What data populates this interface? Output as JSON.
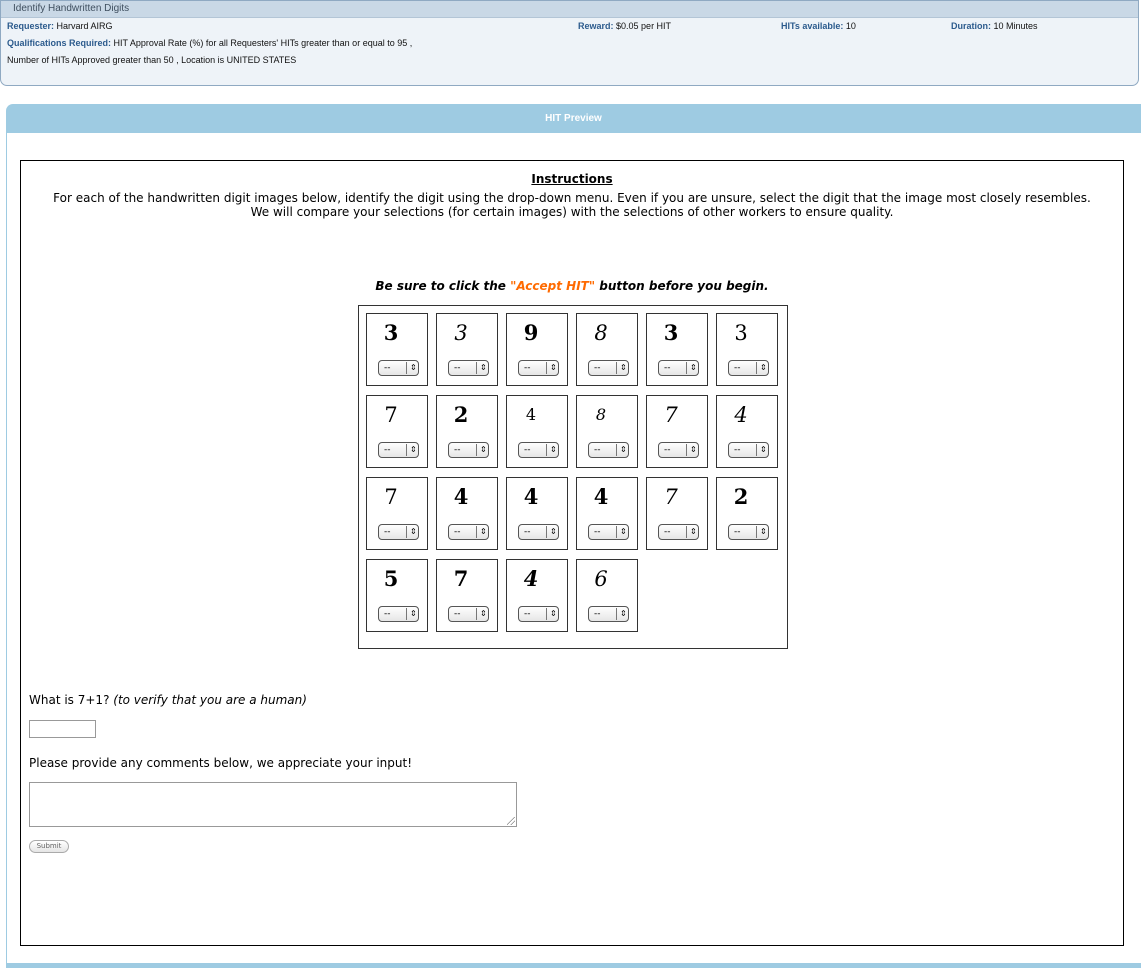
{
  "hit": {
    "title": "Identify Handwritten Digits",
    "requester_label": "Requester:",
    "requester": "Harvard AIRG",
    "reward_label": "Reward:",
    "reward": "$0.05 per HIT",
    "available_label": "HITs available:",
    "available": "10",
    "duration_label": "Duration:",
    "duration": "10 Minutes",
    "quals_label": "Qualifications Required:",
    "quals_line1": "HIT Approval Rate (%) for all Requesters' HITs  greater than or equal to  95 ,",
    "quals_line2": "Number of HITs Approved  greater than  50 , Location  is  UNITED STATES"
  },
  "preview": {
    "title": "HIT Preview"
  },
  "instructions": {
    "title": "Instructions",
    "line1": "For each of the handwritten digit images below, identify the digit using the drop-down menu. Even if you are unsure, select the digit that the image most closely resembles.",
    "line2": "We will compare your selections (for certain images) with the selections of other workers to ensure quality.",
    "accept_pre": "Be sure to click the ",
    "accept_hl": "\"Accept HIT\"",
    "accept_post": " button before you begin."
  },
  "digits": [
    {
      "glyph": "3",
      "value": "--"
    },
    {
      "glyph": "3",
      "value": "--"
    },
    {
      "glyph": "9",
      "value": "--"
    },
    {
      "glyph": "8",
      "value": "--"
    },
    {
      "glyph": "3",
      "value": "--"
    },
    {
      "glyph": "3",
      "value": "--"
    },
    {
      "glyph": "7",
      "value": "--"
    },
    {
      "glyph": "2",
      "value": "--"
    },
    {
      "glyph": "4",
      "value": "--"
    },
    {
      "glyph": "8",
      "value": "--"
    },
    {
      "glyph": "7",
      "value": "--"
    },
    {
      "glyph": "4",
      "value": "--"
    },
    {
      "glyph": "7",
      "value": "--"
    },
    {
      "glyph": "4",
      "value": "--"
    },
    {
      "glyph": "4",
      "value": "--"
    },
    {
      "glyph": "4",
      "value": "--"
    },
    {
      "glyph": "7",
      "value": "--"
    },
    {
      "glyph": "2",
      "value": "--"
    },
    {
      "glyph": "5",
      "value": "--"
    },
    {
      "glyph": "7",
      "value": "--"
    },
    {
      "glyph": "4",
      "value": "--"
    },
    {
      "glyph": "6",
      "value": "--"
    }
  ],
  "form": {
    "question": "What is 7+1?",
    "question_hint": "(to verify that you are a human)",
    "answer_value": "",
    "comments_label": "Please provide any comments below, we appreciate your input!",
    "comments_value": "",
    "submit_label": "Submit"
  }
}
